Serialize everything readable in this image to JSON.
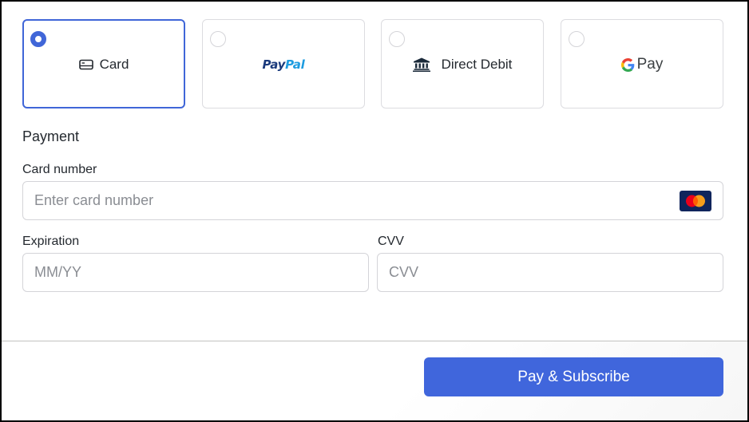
{
  "payment_methods": [
    {
      "id": "card",
      "label": "Card",
      "icon": "credit-card-icon",
      "selected": true
    },
    {
      "id": "paypal",
      "label_part1": "Pay",
      "label_part2": "Pal",
      "icon": "paypal-logo",
      "selected": false
    },
    {
      "id": "direct-debit",
      "label": "Direct Debit",
      "icon": "bank-icon",
      "selected": false
    },
    {
      "id": "google-pay",
      "label": "Pay",
      "icon": "google-g-logo",
      "selected": false
    }
  ],
  "form": {
    "section_title": "Payment",
    "card_number": {
      "label": "Card number",
      "placeholder": "Enter card number",
      "value": "",
      "brand_icon": "mastercard-icon"
    },
    "expiration": {
      "label": "Expiration",
      "placeholder": "MM/YY",
      "value": ""
    },
    "cvv": {
      "label": "CVV",
      "placeholder": "CVV",
      "value": ""
    }
  },
  "footer": {
    "submit_label": "Pay & Subscribe"
  },
  "colors": {
    "accent": "#4066dc",
    "border": "#d4d4d8",
    "text": "#24292f",
    "placeholder": "#8a8d93",
    "mastercard_red": "#eb001b",
    "mastercard_orange": "#f79e1b",
    "mastercard_bg": "#10255c"
  }
}
